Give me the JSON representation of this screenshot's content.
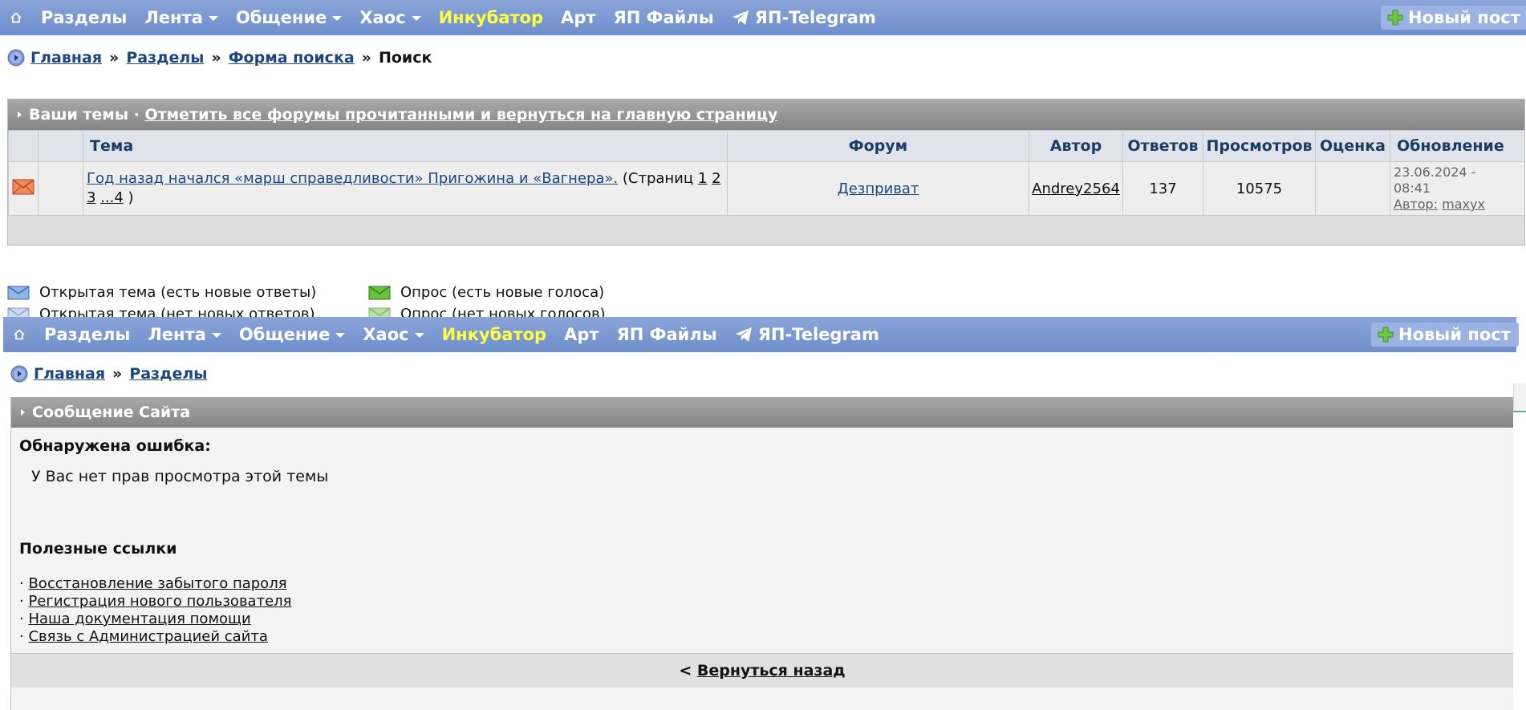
{
  "nav": {
    "items": [
      {
        "label": "Разделы",
        "dropdown": false
      },
      {
        "label": "Лента",
        "dropdown": true
      },
      {
        "label": "Общение",
        "dropdown": true
      },
      {
        "label": "Хаос",
        "dropdown": true
      },
      {
        "label": "Инкубатор",
        "dropdown": false,
        "highlight": "#ffff44"
      },
      {
        "label": "Арт",
        "dropdown": false
      },
      {
        "label": "ЯП Файлы",
        "dropdown": false
      },
      {
        "label": "ЯП-Telegram",
        "dropdown": false,
        "icon": "telegram-icon"
      }
    ],
    "new_post": "Новый пост"
  },
  "top": {
    "breadcrumb": {
      "home": "Главная",
      "sections": "Разделы",
      "search_form": "Форма поиска",
      "current": "Поиск",
      "sep": "»"
    },
    "topics": {
      "title": "Ваши темы ·",
      "mark_read": "Отметить все форумы прочитанными и вернуться на главную страницу",
      "columns": {
        "topic": "Тема",
        "forum": "Форум",
        "author": "Автор",
        "replies": "Ответов",
        "views": "Просмотров",
        "rating": "Оценка",
        "updated": "Обновление"
      },
      "row": {
        "topic": "Год назад начался «марш справедливости» Пригожина и «Вагнера».",
        "pages_prefix": "(Страниц",
        "page1": "1",
        "page2": "2",
        "page3": "3",
        "ellipsis": "...",
        "page4": "4",
        "pages_suffix": ")",
        "forum": "Дезприват",
        "author": "Andrey2564",
        "replies": "137",
        "views": "10575",
        "rating": "",
        "updated_date": "23.06.2024 -",
        "updated_time": "08:41",
        "updated_by_label": "Автор:",
        "updated_by": "maxyx"
      }
    },
    "legend": {
      "open_new": "Открытая тема (есть новые ответы)",
      "poll_new": "Опрос (есть новые голоса)",
      "open_old": "Открытая тема (нет новых ответов)",
      "poll_old": "Опрос (нет новых голосов)"
    }
  },
  "bottom": {
    "breadcrumb": {
      "home": "Главная",
      "sections": "Разделы",
      "sep": "»"
    },
    "error": {
      "title": "Сообщение Сайта",
      "heading": "Обнаружена ошибка:",
      "message": "У Вас нет прав просмотра этой темы",
      "useful_title": "Полезные ссылки",
      "links": [
        "Восстановление забытого пароля",
        "Регистрация нового пользователя",
        "Наша документация помощи",
        "Связь с Администрацией сайта"
      ],
      "back_prefix": "<",
      "back": "Вернуться назад"
    }
  },
  "colors": {
    "nav": "#7b98d2",
    "highlight": "#ffff44",
    "link": "#1c4680",
    "header_gray": "#959595"
  }
}
